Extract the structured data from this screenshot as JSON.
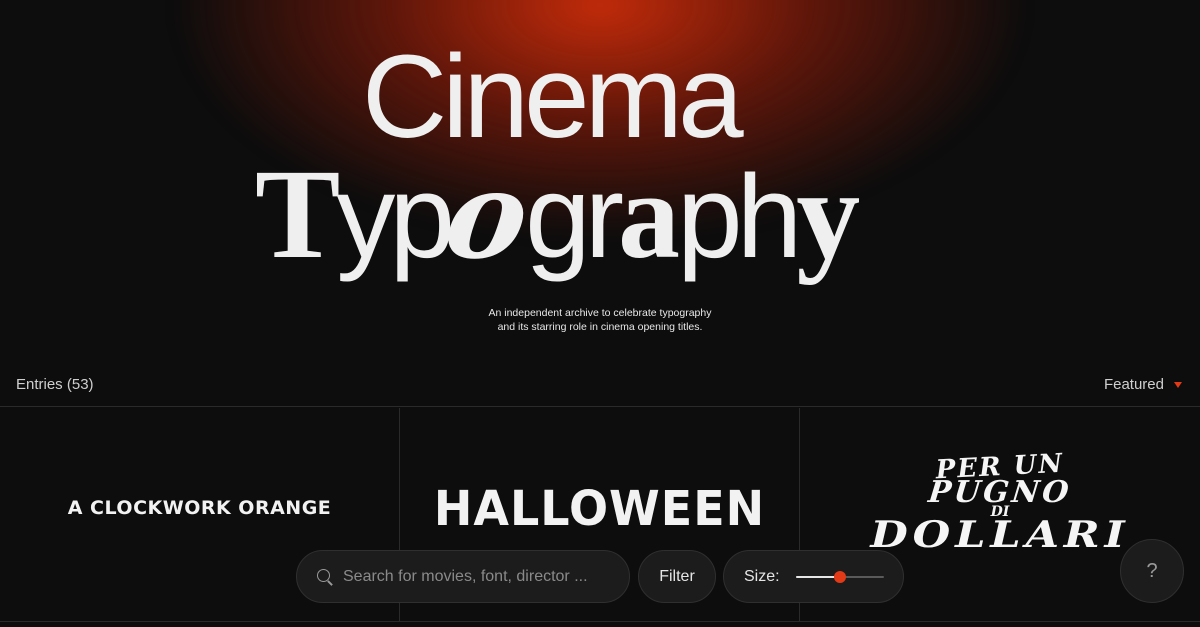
{
  "hero": {
    "title_line1": "Cinema",
    "title_line2": {
      "T": "T",
      "yp": "yp",
      "o": "o",
      "gr": "gr",
      "a": "a",
      "ph": "ph",
      "y": "y"
    },
    "subtitle_line1": "An independent archive to celebrate typography",
    "subtitle_line2": "and its starring role in cinema opening titles."
  },
  "entries": {
    "label": "Entries (53)",
    "sort_label": "Featured"
  },
  "grid": [
    {
      "title": "A CLOCKWORK ORANGE"
    },
    {
      "title": "HALLOWEEN"
    },
    {
      "title_lines": [
        "PER UN",
        "PUGNO",
        "DI",
        "DOLLARI"
      ]
    }
  ],
  "toolbar": {
    "search_placeholder": "Search for movies, font, director ...",
    "filter_label": "Filter",
    "size_label": "Size:",
    "size_value": 0.5
  },
  "help": {
    "label": "?"
  },
  "colors": {
    "accent": "#e23a16",
    "background": "#0d0d0d",
    "glow": "#cd2d0a"
  }
}
